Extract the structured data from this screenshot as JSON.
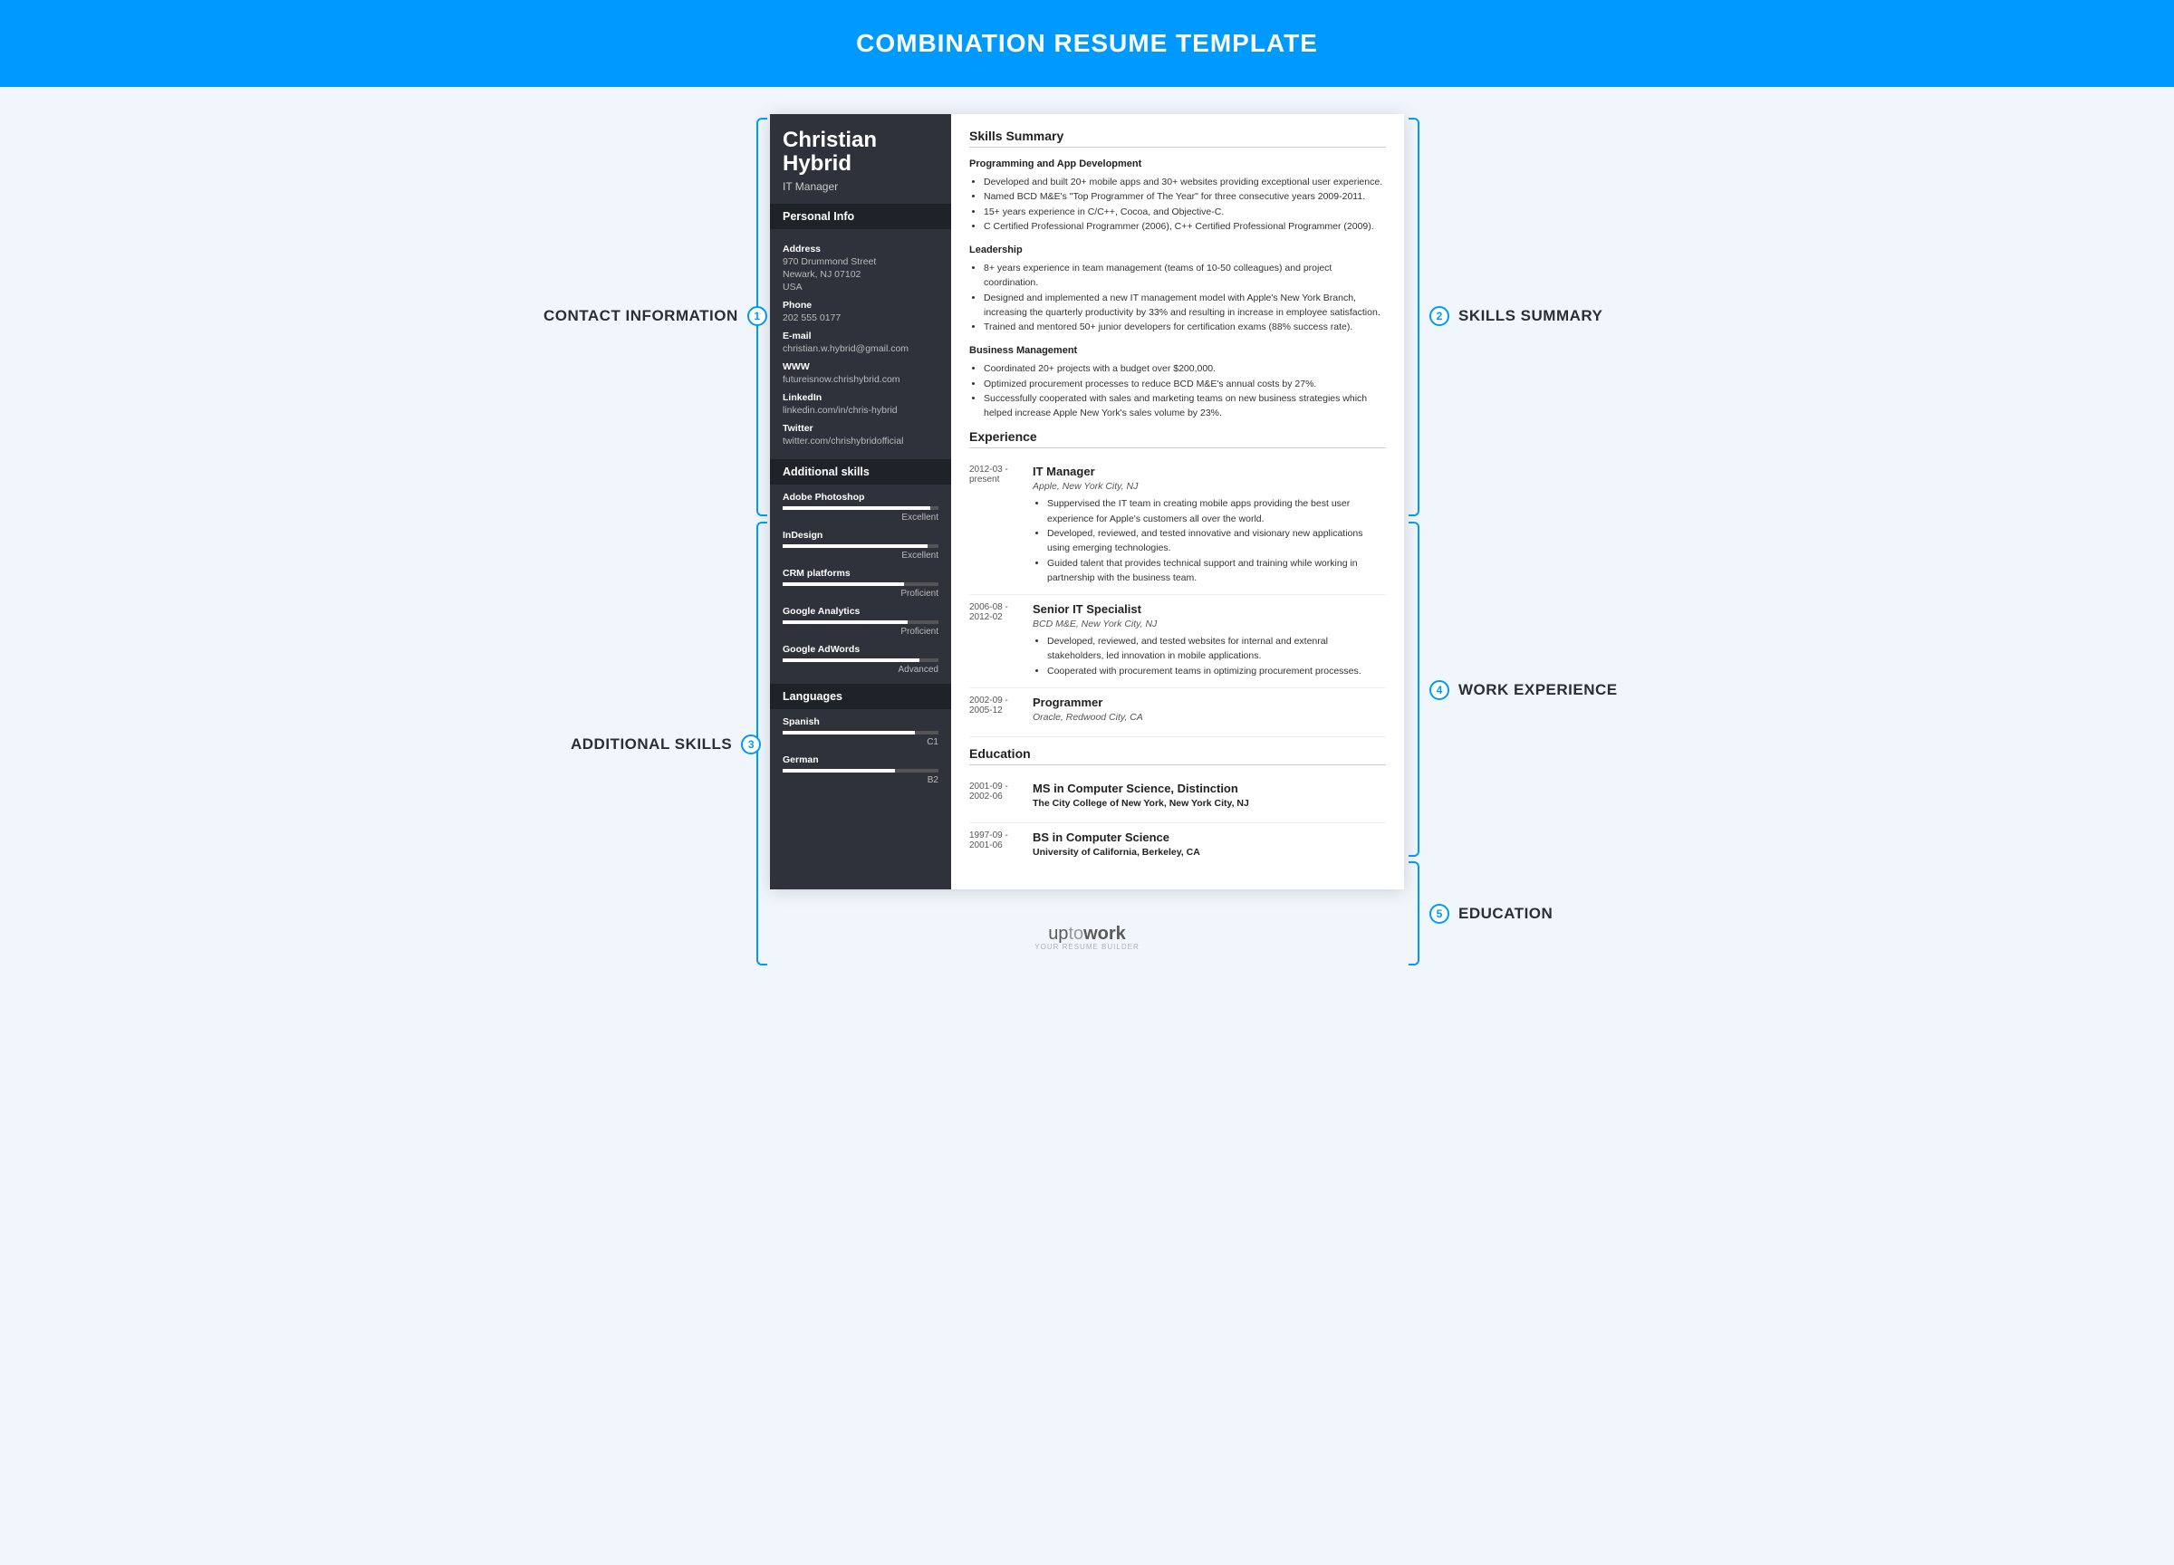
{
  "banner": "COMBINATION RESUME TEMPLATE",
  "callouts": {
    "c1": "CONTACT INFORMATION",
    "c2": "SKILLS SUMMARY",
    "c3": "ADDITIONAL SKILLS",
    "c4": "WORK EXPERIENCE",
    "c5": "EDUCATION"
  },
  "person": {
    "first": "Christian",
    "last": "Hybrid",
    "title": "IT Manager"
  },
  "contact": {
    "heading": "Personal Info",
    "address_lbl": "Address",
    "address1": "970 Drummond Street",
    "address2": "Newark, NJ 07102",
    "address3": "USA",
    "phone_lbl": "Phone",
    "phone": "202 555 0177",
    "email_lbl": "E-mail",
    "email": "christian.w.hybrid@gmail.com",
    "www_lbl": "WWW",
    "www": "futureisnow.chrishybrid.com",
    "linkedin_lbl": "LinkedIn",
    "linkedin": "linkedin.com/in/chris-hybrid",
    "twitter_lbl": "Twitter",
    "twitter": "twitter.com/chrishybridofficial"
  },
  "addskills": {
    "heading": "Additional skills",
    "s0": {
      "name": "Adobe Photoshop",
      "level": "Excellent",
      "pct": 95
    },
    "s1": {
      "name": "InDesign",
      "level": "Excellent",
      "pct": 93
    },
    "s2": {
      "name": "CRM platforms",
      "level": "Proficient",
      "pct": 78
    },
    "s3": {
      "name": "Google Analytics",
      "level": "Proficient",
      "pct": 80
    },
    "s4": {
      "name": "Google AdWords",
      "level": "Advanced",
      "pct": 88
    }
  },
  "languages": {
    "heading": "Languages",
    "l0": {
      "name": "Spanish",
      "level": "C1",
      "pct": 85
    },
    "l1": {
      "name": "German",
      "level": "B2",
      "pct": 72
    }
  },
  "skills": {
    "heading": "Skills Summary",
    "g0": {
      "title": "Programming and App Development",
      "b0": "Developed and built 20+ mobile apps and 30+ websites providing exceptional user experience.",
      "b1": "Named BCD M&E's \"Top Programmer of The Year\" for three consecutive years 2009-2011.",
      "b2": "15+ years experience in C/C++, Cocoa, and Objective-C.",
      "b3": "C Certified Professional Programmer (2006), C++ Certified Professional Programmer (2009)."
    },
    "g1": {
      "title": "Leadership",
      "b0": "8+ years experience in team management (teams of 10-50 colleagues) and project coordination.",
      "b1": "Designed and implemented a new IT management model with Apple's New York Branch, increasing the quarterly productivity by 33% and resulting in increase in employee satisfaction.",
      "b2": "Trained and mentored 50+ junior developers for certification exams (88% success rate)."
    },
    "g2": {
      "title": "Business Management",
      "b0": "Coordinated 20+ projects with a budget over $200,000.",
      "b1": "Optimized procurement processes to reduce BCD M&E's annual costs by 27%.",
      "b2": "Successfully cooperated with sales and marketing teams on new business strategies which helped increase Apple New York's sales volume by 23%."
    }
  },
  "experience": {
    "heading": "Experience",
    "e0": {
      "dates": "2012-03 - present",
      "role": "IT Manager",
      "org": "Apple, New York City, NJ",
      "b0": "Suppervised the IT team in creating mobile apps providing the best user experience for Apple's customers all over the world.",
      "b1": "Developed, reviewed, and tested innovative and visionary new applications using emerging technologies.",
      "b2": "Guided talent that provides technical support and training while working in partnership with the business team."
    },
    "e1": {
      "dates": "2006-08 - 2012-02",
      "role": "Senior IT Specialist",
      "org": "BCD M&E, New York City, NJ",
      "b0": "Developed, reviewed, and tested websites for internal and extenral stakeholders, led innovation in mobile applications.",
      "b1": "Cooperated with procurement teams in optimizing procurement processes."
    },
    "e2": {
      "dates": "2002-09 - 2005-12",
      "role": "Programmer",
      "org": "Oracle, Redwood City, CA"
    }
  },
  "education": {
    "heading": "Education",
    "d0": {
      "dates": "2001-09 - 2002-06",
      "deg": "MS in Computer Science, Distinction",
      "school": "The City College of New York, New York City, NJ"
    },
    "d1": {
      "dates": "1997-09 - 2001-06",
      "deg": "BS in Computer Science",
      "school": "University of California, Berkeley, CA"
    }
  },
  "footer": {
    "p1": "up",
    "p2": "to",
    "p3": "work",
    "tag": "YOUR RESUME BUILDER"
  }
}
